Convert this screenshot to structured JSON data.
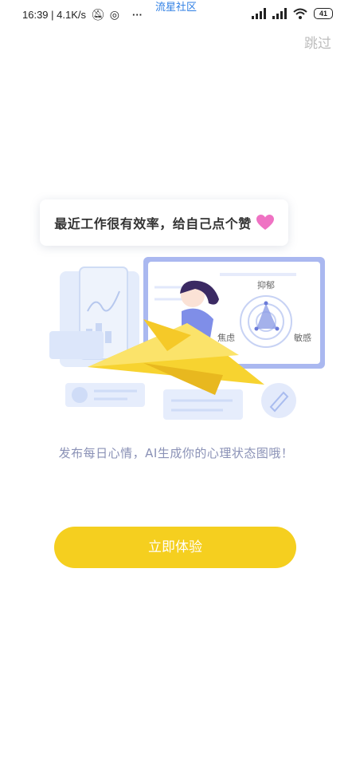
{
  "status_bar": {
    "time_speed": "16:39 | 4.1K/s",
    "more": "···",
    "carrier_banner": "流星社区",
    "battery": "41"
  },
  "header": {
    "skip_label": "跳过"
  },
  "illustration": {
    "speech_bubble": "最近工作很有效率，给自己点个赞",
    "radar_labels": [
      "抑郁",
      "焦虑",
      "敏感"
    ]
  },
  "main": {
    "tagline": "发布每日心情，AI生成你的心理状态图哦！",
    "cta_label": "立即体验"
  },
  "colors": {
    "accent": "#f5cf1f",
    "tagline": "#8a91b6",
    "link": "#2f7fe4"
  }
}
